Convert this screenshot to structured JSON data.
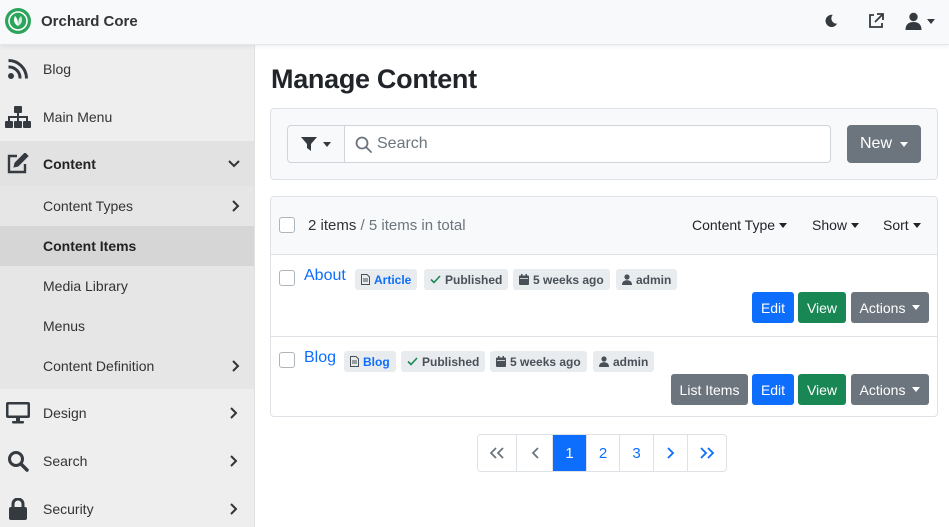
{
  "app": {
    "brand_name": "Orchard Core",
    "brand_color": "#2aa55b",
    "top_icons": [
      "moon-icon",
      "external-link-icon",
      "user-icon"
    ]
  },
  "sidebar": {
    "items": [
      {
        "label": "Blog",
        "icon": "rss-icon"
      },
      {
        "label": "Main Menu",
        "icon": "sitemap-icon"
      },
      {
        "label": "Content",
        "icon": "edit-icon",
        "expanded": true
      },
      {
        "label": "Design",
        "icon": "monitor-icon"
      },
      {
        "label": "Search",
        "icon": "search-icon"
      },
      {
        "label": "Security",
        "icon": "lock-icon"
      }
    ],
    "content_children": [
      {
        "label": "Content Types",
        "has_children": true
      },
      {
        "label": "Content Items",
        "selected": true
      },
      {
        "label": "Media Library"
      },
      {
        "label": "Menus"
      },
      {
        "label": "Content Definition",
        "has_children": true
      }
    ]
  },
  "page": {
    "title": "Manage Content"
  },
  "filter": {
    "search_placeholder": "Search",
    "search_value": "",
    "new_label": "New"
  },
  "list": {
    "count_label": "2 items",
    "total_label": "/ 5 items in total",
    "header_actions": {
      "content_type": "Content Type",
      "show": "Show",
      "sort": "Sort"
    },
    "items": [
      {
        "title": "About",
        "type": "Article",
        "status": "Published",
        "modified": "5 weeks ago",
        "owner": "admin",
        "actions": {
          "edit": "Edit",
          "view": "View",
          "more": "Actions"
        }
      },
      {
        "title": "Blog",
        "type": "Blog",
        "status": "Published",
        "modified": "5 weeks ago",
        "owner": "admin",
        "actions": {
          "list_items": "List Items",
          "edit": "Edit",
          "view": "View",
          "more": "Actions"
        }
      }
    ]
  },
  "pagination": {
    "pages": [
      "1",
      "2",
      "3"
    ],
    "current": "1"
  },
  "colors": {
    "primary": "#0d6efd",
    "success": "#198754",
    "secondary": "#6c757d"
  }
}
